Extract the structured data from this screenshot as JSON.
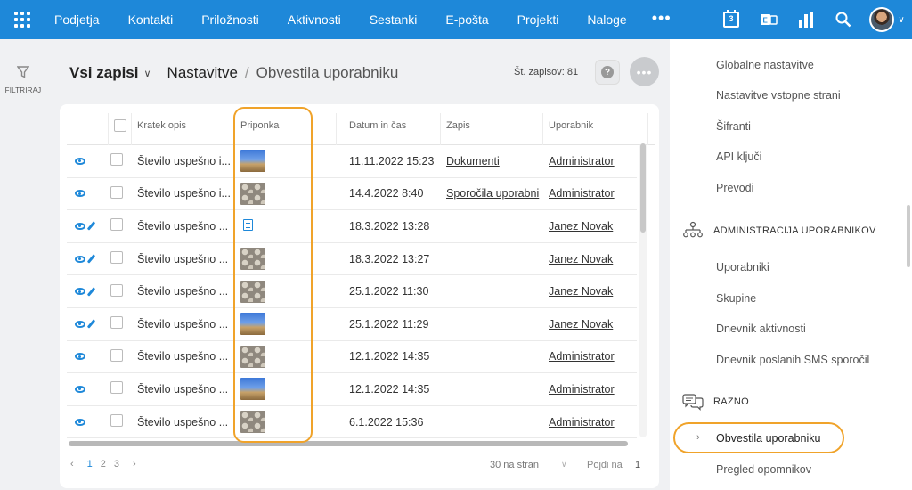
{
  "topnav": {
    "items": [
      "Podjetja",
      "Kontakti",
      "Priložnosti",
      "Aktivnosti",
      "Sestanki",
      "E-pošta",
      "Projekti",
      "Naloge"
    ],
    "more": "•••",
    "calendar_day": "3"
  },
  "left": {
    "filter_label": "FILTRIRAJ"
  },
  "header": {
    "view": "Vsi zapisi",
    "crumb1": "Nastavitve",
    "separator": "/",
    "crumb2": "Obvestila uporabniku",
    "record_count": "Št. zapisov: 81",
    "more": "•••"
  },
  "table": {
    "columns": [
      "Kratek opis",
      "Priponka",
      "Datum in čas",
      "Zapis",
      "Uporabnik"
    ],
    "rows": [
      {
        "opis": "Število uspešno i...",
        "attach": "sky",
        "datum": "11.11.2022 15:23",
        "zapis": "Dokumenti",
        "user": "Administrator",
        "edit": false
      },
      {
        "opis": "Število uspešno i...",
        "attach": "hex",
        "datum": "14.4.2022 8:40",
        "zapis": "Sporočila uporabni",
        "user": "Administrator",
        "edit": false
      },
      {
        "opis": "Število uspešno ...",
        "attach": "doc",
        "datum": "18.3.2022 13:28",
        "zapis": "",
        "user": "Janez Novak",
        "edit": true
      },
      {
        "opis": "Število uspešno ...",
        "attach": "hex",
        "datum": "18.3.2022 13:27",
        "zapis": "",
        "user": "Janez Novak",
        "edit": true
      },
      {
        "opis": "Število uspešno ...",
        "attach": "hex",
        "datum": "25.1.2022 11:30",
        "zapis": "",
        "user": "Janez Novak",
        "edit": true
      },
      {
        "opis": "Število uspešno ...",
        "attach": "sky",
        "datum": "25.1.2022 11:29",
        "zapis": "",
        "user": "Janez Novak",
        "edit": true
      },
      {
        "opis": "Število uspešno ...",
        "attach": "hex",
        "datum": "12.1.2022 14:35",
        "zapis": "",
        "user": "Administrator",
        "edit": false
      },
      {
        "opis": "Število uspešno ...",
        "attach": "sky",
        "datum": "12.1.2022 14:35",
        "zapis": "",
        "user": "Administrator",
        "edit": false
      },
      {
        "opis": "Število uspešno ...",
        "attach": "hex",
        "datum": "6.1.2022 15:36",
        "zapis": "",
        "user": "Administrator",
        "edit": false
      }
    ]
  },
  "pager": {
    "prev": "‹",
    "pages": [
      "1",
      "2",
      "3"
    ],
    "next": "›",
    "per_page": "30 na stran",
    "goto_label": "Pojdi na",
    "goto_value": "1"
  },
  "rpanel": {
    "items_top": [
      "Globalne nastavitve",
      "Nastavitve vstopne strani",
      "Šifranti",
      "API ključi",
      "Prevodi"
    ],
    "section_admin": "ADMINISTRACIJA UPORABNIKOV",
    "items_admin": [
      "Uporabniki",
      "Skupine",
      "Dnevnik aktivnosti",
      "Dnevnik poslanih SMS sporočil"
    ],
    "section_misc": "RAZNO",
    "active_item": "Obvestila uporabniku",
    "last_item": "Pregled opomnikov"
  },
  "colors": {
    "brand": "#1e88d9",
    "highlight": "#f0a32a"
  }
}
